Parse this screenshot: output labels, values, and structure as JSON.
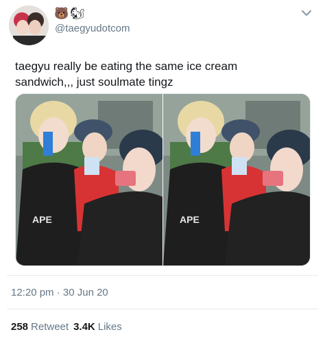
{
  "tweet": {
    "display_name_emoji": [
      "🐻",
      "🐿"
    ],
    "handle": "@taegyudotcom",
    "text": "taegyu really be eating the same ice cream\nsandwich,,, just soulmate tingz",
    "timestamp": "12:20 pm · 30 Jun 20",
    "retweets": {
      "count": "258",
      "label": "Retweet"
    },
    "likes": {
      "count": "3.4K",
      "label": "Likes"
    }
  },
  "icons": {
    "menu": "chevron-down-icon"
  },
  "media": {
    "photos": [
      {
        "shirt_text": "APE"
      },
      {
        "shirt_text": "APE"
      }
    ]
  },
  "colors": {
    "secondary_text": "#657786",
    "primary_text": "#14171a",
    "divider": "#e6ecf0"
  }
}
